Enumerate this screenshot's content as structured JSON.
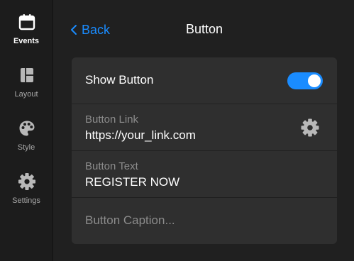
{
  "sidebar": {
    "items": [
      {
        "label": "Events",
        "icon": "calendar-icon",
        "active": true
      },
      {
        "label": "Layout",
        "icon": "layout-icon",
        "active": false
      },
      {
        "label": "Style",
        "icon": "palette-icon",
        "active": false
      },
      {
        "label": "Settings",
        "icon": "gear-icon",
        "active": false
      }
    ]
  },
  "header": {
    "back_label": "Back",
    "title": "Button"
  },
  "panel": {
    "show_button": {
      "label": "Show Button",
      "enabled": true
    },
    "button_link": {
      "label": "Button Link",
      "value": "https://your_link.com"
    },
    "button_text": {
      "label": "Button Text",
      "value": "REGISTER NOW"
    },
    "button_caption": {
      "placeholder": "Button Caption..."
    }
  },
  "colors": {
    "accent": "#1a8cff",
    "background": "#202020",
    "sidebar": "#1c1c1c",
    "panel": "#2f2f2f",
    "muted_text": "#8c8c8c",
    "icon": "#b8b8b8"
  }
}
